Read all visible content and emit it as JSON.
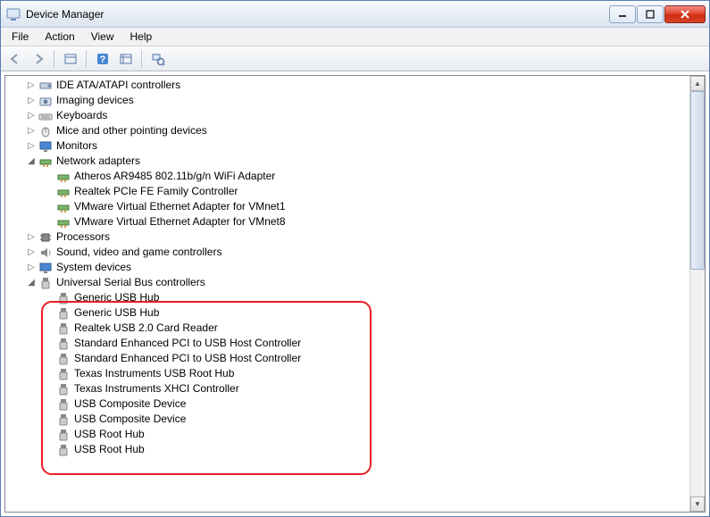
{
  "window": {
    "title": "Device Manager"
  },
  "menu": {
    "file": "File",
    "action": "Action",
    "view": "View",
    "help": "Help"
  },
  "tree": {
    "ide": "IDE ATA/ATAPI controllers",
    "imaging": "Imaging devices",
    "keyboards": "Keyboards",
    "mice": "Mice and other pointing devices",
    "monitors": "Monitors",
    "network": {
      "label": "Network adapters",
      "children": [
        "Atheros AR9485 802.11b/g/n WiFi Adapter",
        "Realtek PCIe FE Family Controller",
        "VMware Virtual Ethernet Adapter for VMnet1",
        "VMware Virtual Ethernet Adapter for VMnet8"
      ]
    },
    "processors": "Processors",
    "sound": "Sound, video and game controllers",
    "system": "System devices",
    "usb": {
      "label": "Universal Serial Bus controllers",
      "children": [
        "Generic USB Hub",
        "Generic USB Hub",
        "Realtek USB 2.0 Card Reader",
        "Standard Enhanced PCI to USB Host Controller",
        "Standard Enhanced PCI to USB Host Controller",
        "Texas Instruments USB Root Hub",
        "Texas Instruments XHCI Controller",
        "USB Composite Device",
        "USB Composite Device",
        "USB Root Hub",
        "USB Root Hub"
      ]
    }
  }
}
